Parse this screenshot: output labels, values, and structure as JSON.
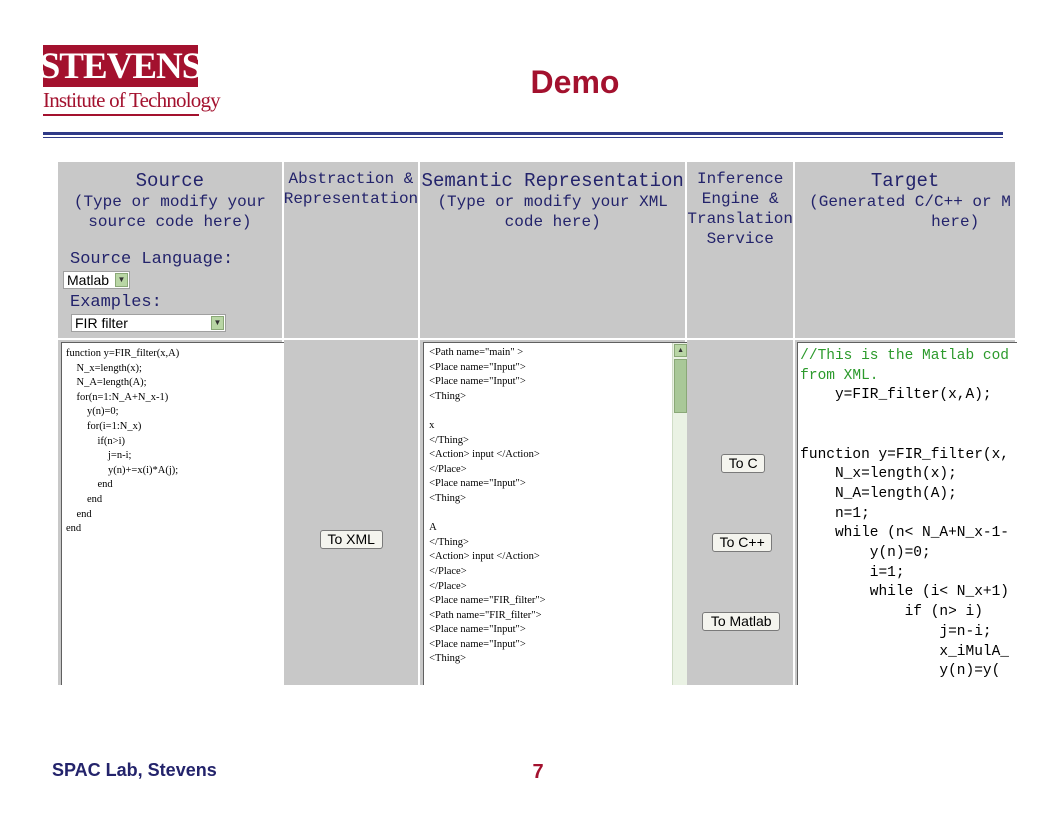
{
  "logo": {
    "name": "STEVENS",
    "subtitle": "Institute of Technology"
  },
  "slide": {
    "title": "Demo",
    "footer": "SPAC Lab, Stevens",
    "page_number": "7"
  },
  "colors": {
    "brand_red": "#a3112e",
    "rule_blue": "#2f3a87",
    "panel_gray": "#c8c8c8",
    "comment_green": "#2c9a2c"
  },
  "app": {
    "columns": {
      "source": {
        "title": "Source",
        "subtitle_1": "(Type or modify your",
        "subtitle_2": "source code here)"
      },
      "abstraction": {
        "line_1": "Abstraction &",
        "line_2": "Representation"
      },
      "semantic": {
        "title": "Semantic Representation",
        "subtitle_1": "(Type or modify your XML",
        "subtitle_2": "code here)"
      },
      "inference": {
        "line_1": "Inference",
        "line_2": "Engine &",
        "line_3": "Translation",
        "line_4": "Service"
      },
      "target": {
        "title": "Target",
        "subtitle_1": "(Generated C/C++ or M",
        "subtitle_2": "here)"
      }
    },
    "source_language": {
      "label": "Source Language:",
      "value": "Matlab"
    },
    "examples": {
      "label": "Examples:",
      "value": "FIR filter"
    },
    "source_code": "function y=FIR_filter(x,A)\n    N_x=length(x);\n    N_A=length(A);\n    for(n=1:N_A+N_x-1)\n        y(n)=0;\n        for(i=1:N_x)\n            if(n>i)\n                j=n-i;\n                y(n)+=x(i)*A(j);\n            end\n        end\n    end\nend",
    "xml_code": "<Path name=\"main\" >\n<Place name=\"Input\">\n<Place name=\"Input\">\n<Thing>\n\nx\n</Thing>\n<Action> input </Action>\n</Place>\n<Place name=\"Input\">\n<Thing>\n\nA\n</Thing>\n<Action> input </Action>\n</Place>\n</Place>\n<Place name=\"FIR_filter\">\n<Path name=\"FIR_filter\">\n<Place name=\"Input\">\n<Place name=\"Input\">\n<Thing>",
    "target_comment": "//This is the Matlab cod\nfrom XML.",
    "target_code": "\n    y=FIR_filter(x,A);\n\n\nfunction y=FIR_filter(x,\n    N_x=length(x);\n    N_A=length(A);\n    n=1;\n    while (n< N_A+N_x-1-\n        y(n)=0;\n        i=1;\n        while (i< N_x+1)\n            if (n> i)\n                j=n-i;\n                x_iMulA_\n                y(n)=y(",
    "buttons": {
      "to_xml": "To XML",
      "to_c": "To C",
      "to_cpp": "To C++",
      "to_matlab": "To Matlab"
    }
  }
}
